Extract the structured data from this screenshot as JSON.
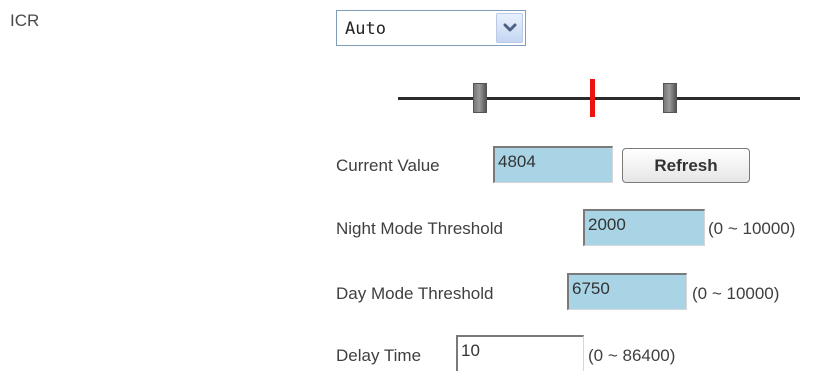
{
  "icr": {
    "label": "ICR",
    "mode_select": {
      "selected": "Auto"
    }
  },
  "slider": {
    "night_threshold": 2000,
    "current_value": 4804,
    "day_threshold": 6750,
    "max": 10000,
    "marker_color": "#ee1111"
  },
  "current_value": {
    "label": "Current Value",
    "value": "4804",
    "refresh_label": "Refresh"
  },
  "night_mode": {
    "label": "Night Mode Threshold",
    "value": "2000",
    "range": "(0 ~ 10000)"
  },
  "day_mode": {
    "label": "Day Mode Threshold",
    "value": "6750",
    "range": "(0 ~ 10000)"
  },
  "delay_time": {
    "label": "Delay Time",
    "value": "10",
    "range": "(0 ~ 86400)"
  },
  "icons": {
    "select_arrow": "chevron-down-icon"
  }
}
